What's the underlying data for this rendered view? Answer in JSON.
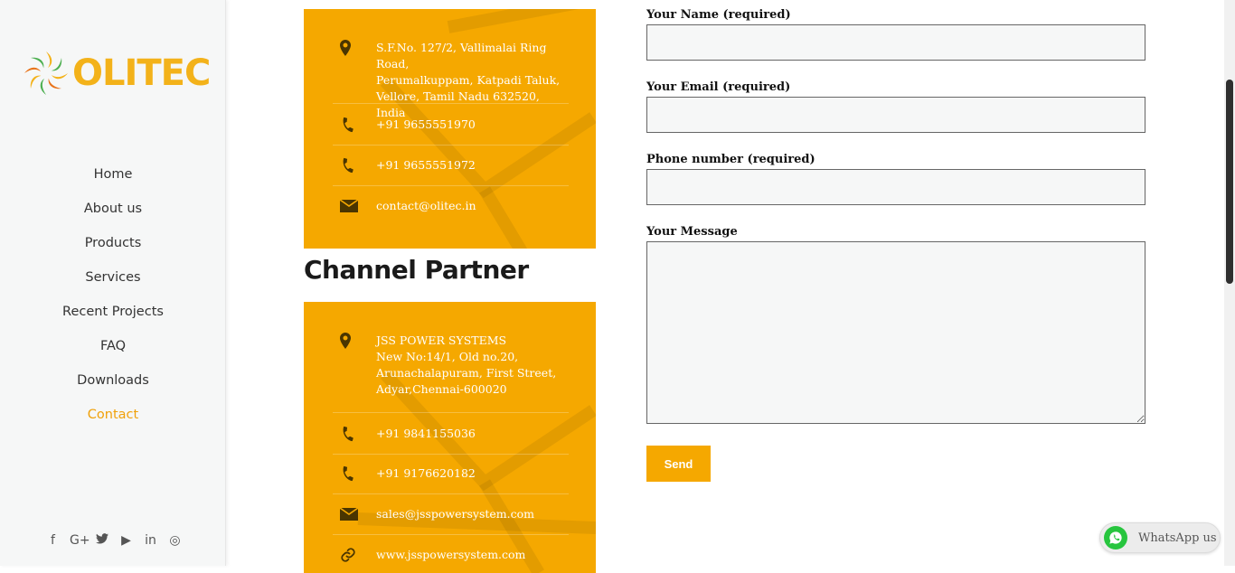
{
  "brand": {
    "name": "OLITEC"
  },
  "nav": {
    "items": [
      {
        "label": "Home"
      },
      {
        "label": "About us"
      },
      {
        "label": "Products"
      },
      {
        "label": "Services"
      },
      {
        "label": "Recent Projects"
      },
      {
        "label": "FAQ"
      },
      {
        "label": "Downloads"
      },
      {
        "label": "Contact",
        "active": true
      }
    ]
  },
  "social": [
    {
      "label": "f",
      "icon": "facebook-icon"
    },
    {
      "label": "G+",
      "icon": "google-plus-icon"
    },
    {
      "label": "🐦",
      "icon": "twitter-icon"
    },
    {
      "label": "▶",
      "icon": "youtube-icon"
    },
    {
      "label": "in",
      "icon": "linkedin-icon"
    },
    {
      "label": "◎",
      "icon": "instagram-icon"
    }
  ],
  "company_card": {
    "address": "S.F.No. 127/2, Vallimalai Ring Road,\nPerumalkuppam, Katpadi Taluk,\nVellore, Tamil Nadu 632520, India",
    "phone1": "+91 9655551970",
    "phone2": "+91 9655551972",
    "email": "contact@olitec.in"
  },
  "channel": {
    "heading": "Channel Partner",
    "address": "JSS POWER SYSTEMS\nNew No:14/1, Old no.20,\nArunachalapuram, First Street,\nAdyar,Chennai-600020",
    "phone1": "+91 9841155036",
    "phone2": "+91 9176620182",
    "email": "sales@jsspowersystem.com",
    "website": "www.jsspowersystem.com"
  },
  "form": {
    "name_label": "Your Name (required)",
    "email_label": "Your Email (required)",
    "phone_label": "Phone number (required)",
    "message_label": "Your Message",
    "send_label": "Send"
  },
  "whatsapp": {
    "label": "WhatsApp us"
  },
  "colors": {
    "accent": "#f5a800",
    "nav_active": "#f0a10a",
    "whatsapp_green": "#27c53e"
  }
}
